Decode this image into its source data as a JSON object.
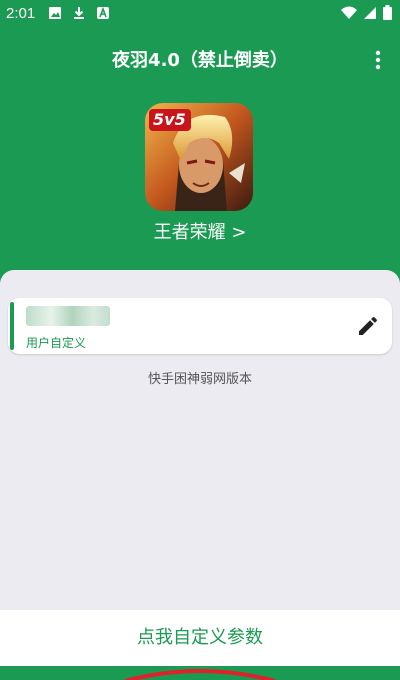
{
  "status_bar": {
    "time": "2:01",
    "left_icons": [
      "image-icon",
      "download-icon",
      "app-a-icon"
    ],
    "right_icons": [
      "wifi-icon",
      "signal-icon",
      "battery-icon"
    ]
  },
  "toolbar": {
    "title": "夜羽4.0（禁止倒卖）",
    "menu_icon": "more-vertical-icon"
  },
  "game": {
    "badge": "5v5",
    "name": "王者荣耀 >"
  },
  "config_card": {
    "subtitle": "用户自定义",
    "edit_icon": "pencil-icon"
  },
  "panel": {
    "note": "快手困神弱网版本"
  },
  "bottom_button": {
    "label": "点我自定义参数"
  },
  "colors": {
    "primary": "#1a9a52",
    "panel_bg": "#ecebf1",
    "annotation": "#e0202a"
  }
}
